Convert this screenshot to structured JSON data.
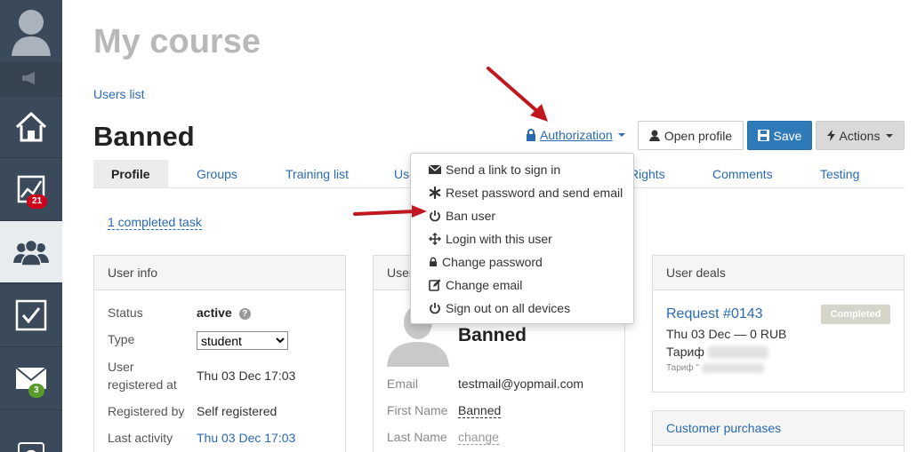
{
  "page": {
    "title": "My course",
    "breadcrumb": "Users list"
  },
  "user": {
    "name": "Banned"
  },
  "header": {
    "authorization_label": "Authorization",
    "open_profile_label": "Open profile",
    "save_label": "Save",
    "actions_label": "Actions"
  },
  "sidebar": {
    "badges": {
      "stats": "21",
      "mail": "3"
    }
  },
  "tabs": [
    "Profile",
    "Groups",
    "Training list",
    "Use",
    "Rights",
    "Comments",
    "Testing"
  ],
  "completed_task": "1 completed task",
  "user_info": {
    "title": "User info",
    "status_label": "Status",
    "status_value": "active",
    "type_label": "Type",
    "type_value": "student",
    "registered_label_1": "User",
    "registered_label_2": "registered at",
    "registered_value": "Thu 03 Dec 17:03",
    "registered_by_label": "Registered by",
    "registered_by_value": "Self registered",
    "last_activity_label": "Last activity",
    "last_activity_value": "Thu 03 Dec 17:03"
  },
  "user_card": {
    "title": "User",
    "name": "Banned",
    "email_label": "Email",
    "email_value": "testmail@yopmail.com",
    "first_name_label": "First Name",
    "first_name_value": "Banned",
    "last_name_label": "Last Name",
    "last_name_value": "change"
  },
  "auth_menu": [
    {
      "icon": "envelope-icon",
      "label": "Send a link to sign in"
    },
    {
      "icon": "asterisk-icon",
      "label": "Reset password and send email"
    },
    {
      "icon": "power-icon",
      "label": "Ban user"
    },
    {
      "icon": "move-icon",
      "label": "Login with this user"
    },
    {
      "icon": "lock-icon",
      "label": "Change password"
    },
    {
      "icon": "edit-icon",
      "label": "Change email"
    },
    {
      "icon": "power-icon",
      "label": "Sign out on all devices"
    }
  ],
  "deals": {
    "title": "User deals",
    "request": "Request #0143",
    "badge": "Completed",
    "date_line": "Thu 03 Dec — 0 RUB",
    "tariff_label": "Тариф",
    "tariff_small": "Тариф \""
  },
  "purchases": {
    "title": "Customer purchases"
  },
  "colors": {
    "sidebar": "#3b4a5b",
    "link": "#2a6ab3",
    "save": "#2f7ab9",
    "arrow": "#c0181e"
  }
}
